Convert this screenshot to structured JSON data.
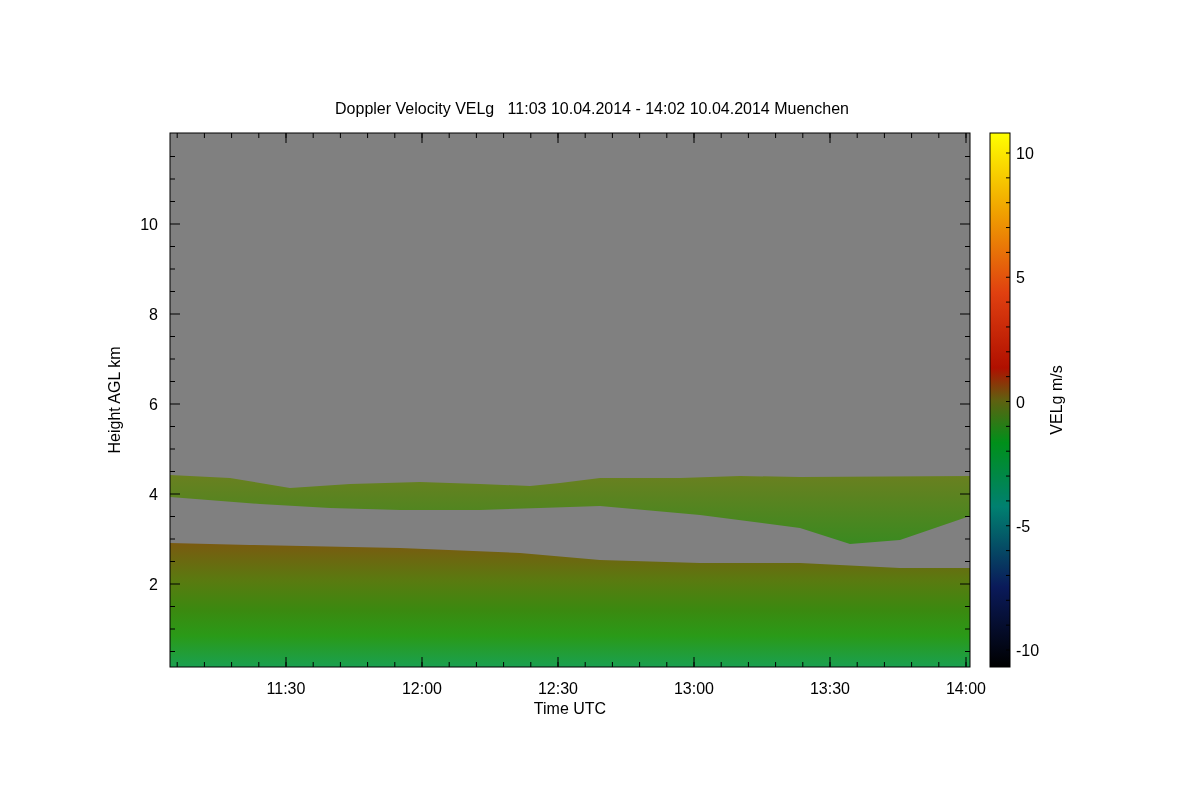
{
  "title": "Doppler Velocity VELg   11:03 10.04.2014 - 14:02 10.04.2014 Muenchen",
  "y_axis": {
    "label": "Height AGL km",
    "ticks": [
      "10",
      "8",
      "6",
      "4",
      "2"
    ]
  },
  "x_axis": {
    "label": "Time UTC",
    "ticks": [
      "11:30",
      "12:00",
      "12:30",
      "13:00",
      "13:30",
      "14:00"
    ]
  },
  "colorbar": {
    "label": "VELg m/s",
    "ticks": [
      "10",
      "5",
      "0",
      "-5",
      "-10"
    ]
  }
}
